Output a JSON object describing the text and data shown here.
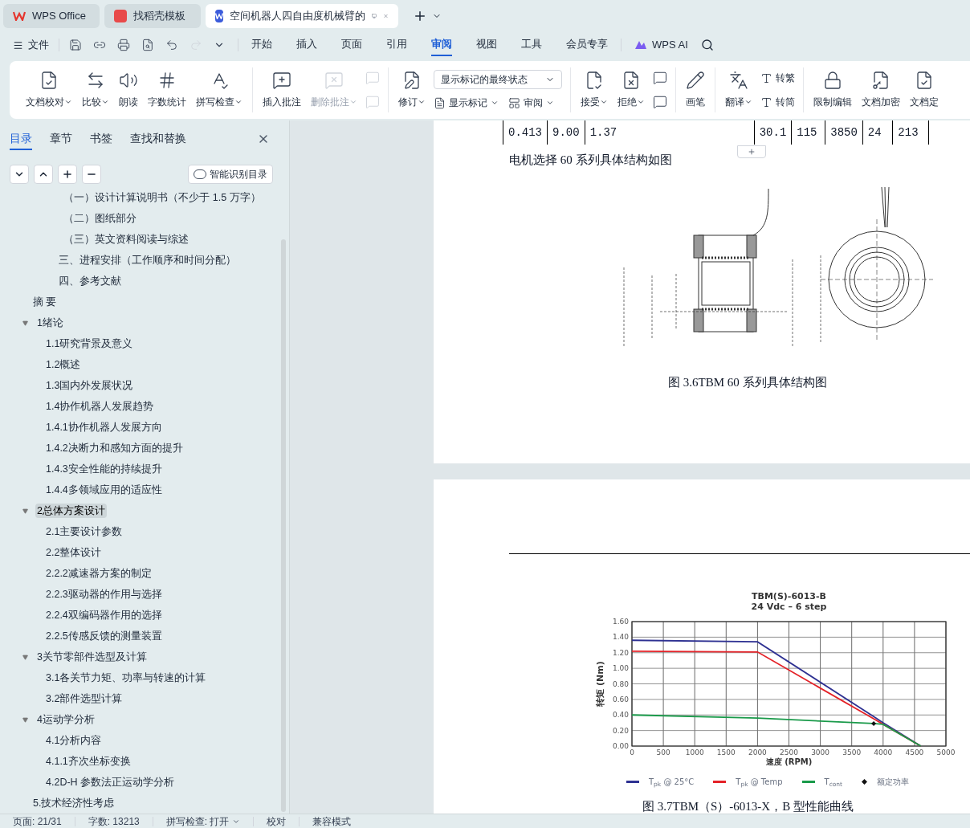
{
  "tabs": [
    {
      "label": "WPS Office",
      "selected": false,
      "kind": "home"
    },
    {
      "label": "找稻壳模板",
      "selected": false,
      "kind": "template"
    },
    {
      "label": "空间机器人四自由度机械臂的",
      "selected": true,
      "kind": "doc"
    }
  ],
  "menu": {
    "file": "文件",
    "tabs": [
      {
        "label": "开始",
        "selected": false
      },
      {
        "label": "插入",
        "selected": false
      },
      {
        "label": "页面",
        "selected": false
      },
      {
        "label": "引用",
        "selected": false
      },
      {
        "label": "审阅",
        "selected": true
      },
      {
        "label": "视图",
        "selected": false
      },
      {
        "label": "工具",
        "selected": false
      },
      {
        "label": "会员专享",
        "selected": false
      }
    ],
    "ai": "WPS AI"
  },
  "ribbon": {
    "groups": [
      [
        {
          "kind": "large",
          "label": "文档校对",
          "dropdown": true,
          "disabled": false
        },
        {
          "kind": "large",
          "label": "比较",
          "dropdown": true,
          "disabled": false
        },
        {
          "kind": "large",
          "label": "朗读",
          "dropdown": false,
          "disabled": false
        },
        {
          "kind": "large",
          "label": "字数统计",
          "dropdown": false,
          "disabled": false
        },
        {
          "kind": "large",
          "label": "拼写检查",
          "dropdown": true,
          "disabled": false
        }
      ],
      [
        {
          "kind": "large",
          "label": "插入批注",
          "dropdown": false,
          "disabled": false
        },
        {
          "kind": "large",
          "label": "删除批注",
          "dropdown": true,
          "disabled": true
        },
        {
          "kind": "pair",
          "disabled": true
        }
      ],
      [
        {
          "kind": "large",
          "label": "修订",
          "dropdown": true,
          "disabled": false
        },
        {
          "kind": "select",
          "label": "显示标记的最终状态",
          "sub": [
            {
              "label": "显示标记",
              "dropdown": true
            },
            {
              "label": "审阅",
              "dropdown": true
            }
          ]
        }
      ],
      [
        {
          "kind": "large",
          "label": "接受",
          "dropdown": true,
          "disabled": false
        },
        {
          "kind": "large",
          "label": "拒绝",
          "dropdown": true,
          "disabled": false
        },
        {
          "kind": "pair",
          "disabled": false
        }
      ],
      [
        {
          "kind": "large",
          "label": "画笔",
          "dropdown": false,
          "disabled": false
        }
      ],
      [
        {
          "kind": "large",
          "label": "翻译",
          "dropdown": true,
          "disabled": false
        },
        {
          "kind": "stack",
          "sub": [
            {
              "label": "转繁",
              "dropdown": false
            },
            {
              "label": "转简",
              "dropdown": false
            }
          ]
        }
      ],
      [
        {
          "kind": "large",
          "label": "限制编辑",
          "dropdown": false,
          "disabled": false
        },
        {
          "kind": "large",
          "label": "文档加密",
          "dropdown": false,
          "disabled": false
        },
        {
          "kind": "large",
          "label": "文档定",
          "dropdown": false,
          "disabled": false
        }
      ]
    ]
  },
  "sidebar": {
    "tabs": [
      {
        "label": "目录",
        "selected": true
      },
      {
        "label": "章节",
        "selected": false
      },
      {
        "label": "书签",
        "selected": false
      },
      {
        "label": "查找和替换",
        "selected": false
      }
    ],
    "smart_button": "智能识别目录",
    "outline": [
      {
        "children": [
          {
            "children": [
              {
                "label": "三、进程安排（工作顺序和时间分配）",
                "selected": false
              },
              {
                "label": "四、参考文献",
                "selected": false
              }
            ],
            "lead": [
              {
                "label": "（一）设计计算说明书（不少于 1.5 万字）",
                "selected": false
              },
              {
                "label": "（二）图纸部分",
                "selected": false
              },
              {
                "label": "（三）英文资料阅读与综述",
                "selected": false
              }
            ]
          }
        ]
      },
      {
        "label": "摘 要",
        "selected": false
      },
      {
        "label": "1绪论",
        "selected": false,
        "expanded": true,
        "children": [
          {
            "label": "1.1研究背景及意义",
            "selected": false
          },
          {
            "label": "1.2概述",
            "selected": false
          },
          {
            "label": "1.3国内外发展状况",
            "selected": false
          },
          {
            "label": "1.4协作机器人发展趋势",
            "selected": false
          },
          {
            "label": "1.4.1协作机器人发展方向",
            "selected": false
          },
          {
            "label": "1.4.2决断力和感知方面的提升",
            "selected": false
          },
          {
            "label": "1.4.3安全性能的持续提升",
            "selected": false
          },
          {
            "label": "1.4.4多领域应用的适应性",
            "selected": false
          }
        ]
      },
      {
        "label": "2总体方案设计",
        "selected": true,
        "expanded": true,
        "children": [
          {
            "label": "2.1主要设计参数",
            "selected": false
          },
          {
            "label": "2.2整体设计",
            "selected": false
          },
          {
            "label": "2.2.2减速器方案的制定",
            "selected": false
          },
          {
            "label": "2.2.3驱动器的作用与选择",
            "selected": false
          },
          {
            "label": "2.2.4双编码器作用的选择",
            "selected": false
          },
          {
            "label": "2.2.5传感反馈的测量装置",
            "selected": false
          }
        ]
      },
      {
        "label": "3关节零部件选型及计算",
        "selected": false,
        "expanded": true,
        "children": [
          {
            "label": "3.1各关节力矩、功率与转速的计算",
            "selected": false
          },
          {
            "label": "3.2部件选型计算",
            "selected": false
          }
        ]
      },
      {
        "label": "4运动学分析",
        "selected": false,
        "expanded": true,
        "children": [
          {
            "label": "4.1分析内容",
            "selected": false
          },
          {
            "label": "4.1.1齐次坐标变换",
            "selected": false
          },
          {
            "label": "4.2D-H 参数法正运动学分析",
            "selected": false
          }
        ]
      },
      {
        "label": "5.技术经济性考虑",
        "selected": false
      }
    ]
  },
  "document": {
    "table_row": [
      "0.413",
      "9.00",
      "1.37",
      "30.1",
      "115",
      "3850",
      "24",
      "213"
    ],
    "intro": "电机选择 60 系列具体结构如图",
    "figure_caption": "图 3.6TBM 60 系列具体结构图",
    "chart_caption": "图 3.7TBM（S）-6013-X，B 型性能曲线",
    "chart_data": {
      "type": "line",
      "title": "TBM(S)-6013-B\n24 Vdc – 6 step",
      "xlabel": "速度 (RPM)",
      "ylabel": "转矩 (Nm)",
      "x": [
        0,
        2000,
        3850,
        4000,
        4600
      ],
      "series": [
        {
          "name": "T$_{pk}$ @ 25°C",
          "color": "#2e3192",
          "values": [
            1.36,
            1.34,
            0.38,
            0.3,
            0
          ]
        },
        {
          "name": "T$_{pk}$ @ Temp",
          "color": "#e42228",
          "values": [
            1.22,
            1.21,
            0.35,
            0.28,
            0
          ]
        },
        {
          "name": "T$_{cont}$",
          "color": "#1a9a4a",
          "values": [
            0.4,
            0.36,
            0.29,
            0.28,
            0
          ]
        },
        {
          "name": "额定功率",
          "type": "scatter",
          "color": "#111111",
          "values": [
            null,
            null,
            0.29,
            null,
            null
          ]
        }
      ],
      "xlim": [
        0,
        5000
      ],
      "ylim": [
        0,
        1.6
      ],
      "xticks": [
        0,
        500,
        1000,
        1500,
        2000,
        2500,
        3000,
        3500,
        4000,
        4500,
        5000
      ],
      "yticks": [
        {
          "value": 0,
          "label": "0.00"
        },
        {
          "value": 0.2,
          "label": "0.20"
        },
        {
          "value": 0.4,
          "label": "0.40"
        },
        {
          "value": 0.6,
          "label": "0.60"
        },
        {
          "value": 0.8,
          "label": "0.80"
        },
        {
          "value": 1,
          "label": "1.00"
        },
        {
          "value": 1.2,
          "label": "1.20"
        },
        {
          "value": 1.4,
          "label": "1.40"
        },
        {
          "value": 1.6,
          "label": "1.60"
        }
      ],
      "grid": true,
      "legend": "bottom"
    }
  },
  "status_bar": [
    {
      "label": "页面: 21/31",
      "dropdown": false
    },
    {
      "label": "字数: 13213",
      "dropdown": false
    },
    {
      "label": "拼写检查: 打开",
      "dropdown": true
    },
    {
      "label": "校对",
      "dropdown": false
    },
    {
      "label": "兼容模式",
      "dropdown": false
    }
  ]
}
